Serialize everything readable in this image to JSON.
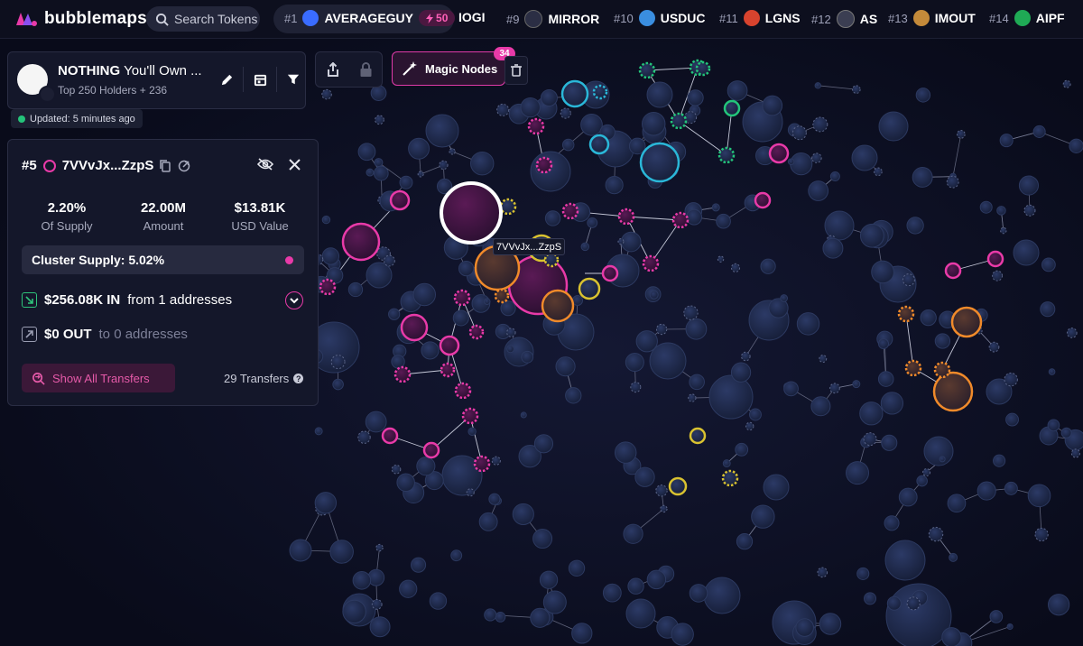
{
  "brand": {
    "name": "bubblemaps"
  },
  "search": {
    "label": "Search Tokens"
  },
  "ticker": [
    {
      "rank": "#1",
      "name": "AVERAGEGUY",
      "boost": "50",
      "icon_color": "#3a6cff"
    },
    {
      "rank": "",
      "name": "IOGI",
      "icon_color": ""
    },
    {
      "rank": "#9",
      "name": "MIRROR",
      "icon_color": "#2b2e44"
    },
    {
      "rank": "#10",
      "name": "USDUC",
      "icon_color": "#3a8ee0"
    },
    {
      "rank": "#11",
      "name": "LGNS",
      "icon_color": "#d8432e"
    },
    {
      "rank": "#12",
      "name": "AS",
      "icon_color": "#3b3e52"
    },
    {
      "rank": "#13",
      "name": "IMOUT",
      "icon_color": "#c48a3a"
    },
    {
      "rank": "#14",
      "name": "AIPF",
      "icon_color": "#1faa55"
    }
  ],
  "token": {
    "name": "NOTHING",
    "name_rest": "You'll Own ...",
    "subtitle": "Top 250 Holders + 236",
    "updated": "Updated: 5 minutes ago"
  },
  "toolbar": {
    "magic_label": "Magic Nodes",
    "magic_count": "34"
  },
  "selected": {
    "rank": "#5",
    "address": "7VVvJx...ZzpS",
    "label_on_map": "7VVvJx...ZzpS",
    "stats": [
      {
        "value": "2.20%",
        "label": "Of Supply"
      },
      {
        "value": "22.00M",
        "label": "Amount"
      },
      {
        "value": "$13.81K",
        "label": "USD Value"
      }
    ],
    "cluster_supply": "Cluster Supply: 5.02%",
    "in_amount": "$256.08K IN",
    "in_from": "from 1 addresses",
    "out_amount": "$0 OUT",
    "out_to": "to 0 addresses",
    "show_transfers": "Show All Transfers",
    "transfer_count": "29 Transfers"
  },
  "colors": {
    "background": "#090b1a",
    "bubble_default": "#1c2746",
    "pink": "#e83aa8",
    "orange": "#f08a2a",
    "yellow": "#d9c230",
    "cyan": "#2ab7d8",
    "green": "#23c47a"
  }
}
